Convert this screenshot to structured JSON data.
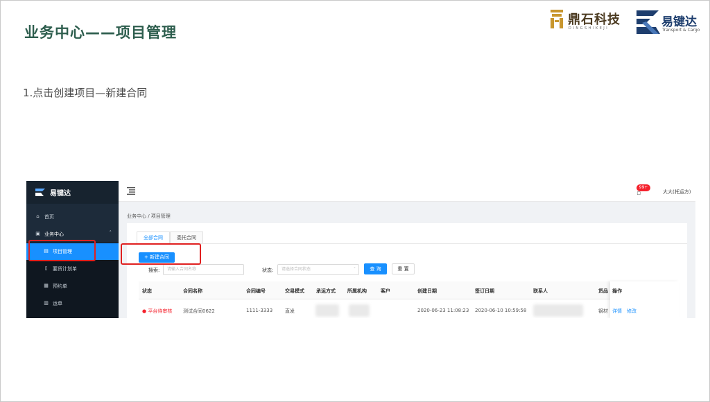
{
  "slide": {
    "title": "业务中心——项目管理",
    "subtitle": "1.点击创建项目—新建合同"
  },
  "logos": {
    "dingshi": {
      "name": "鼎石科技",
      "romanized": "DINGSHIKEJI"
    },
    "yijianda": {
      "name": "易键达",
      "tagline": "Transport & Cargo"
    }
  },
  "app": {
    "brand": "易键达",
    "sidebar": {
      "items": [
        {
          "label": "首页",
          "icon": "home-icon"
        },
        {
          "label": "业务中心",
          "icon": "business-icon",
          "expanded": true
        },
        {
          "label": "项目管理",
          "icon": "file-icon",
          "active": true
        },
        {
          "label": "要货计划单",
          "icon": "document-icon"
        },
        {
          "label": "预约单",
          "icon": "calendar-icon"
        },
        {
          "label": "运单",
          "icon": "list-icon"
        }
      ]
    },
    "header": {
      "badge": "99+",
      "user": "大大(托运方)"
    },
    "breadcrumb": "业务中心 / 项目管理",
    "tabs": [
      "全部合同",
      "委托合同"
    ],
    "new_button": "+ 新建合同",
    "search": {
      "label": "搜索:",
      "placeholder": "请输入合同名称",
      "status_label": "状态:",
      "status_placeholder": "请选择合同状态",
      "query_button": "查 询",
      "reset_button": "重 置"
    },
    "table": {
      "headers": [
        "状态",
        "合同名称",
        "合同编号",
        "交易模式",
        "承运方式",
        "所属机构",
        "客户",
        "创建日期",
        "签订日期",
        "联系人",
        "货品",
        "操作"
      ],
      "rows": [
        {
          "status": "● 平台待审核",
          "name": "测试合同0622",
          "code": "1111-3333",
          "mode": "直发",
          "created": "2020-06-23 11:08:23",
          "signed": "2020-06-10 10:59:58",
          "goods": "钢材",
          "actions": [
            "详情",
            "修改"
          ]
        }
      ]
    }
  }
}
